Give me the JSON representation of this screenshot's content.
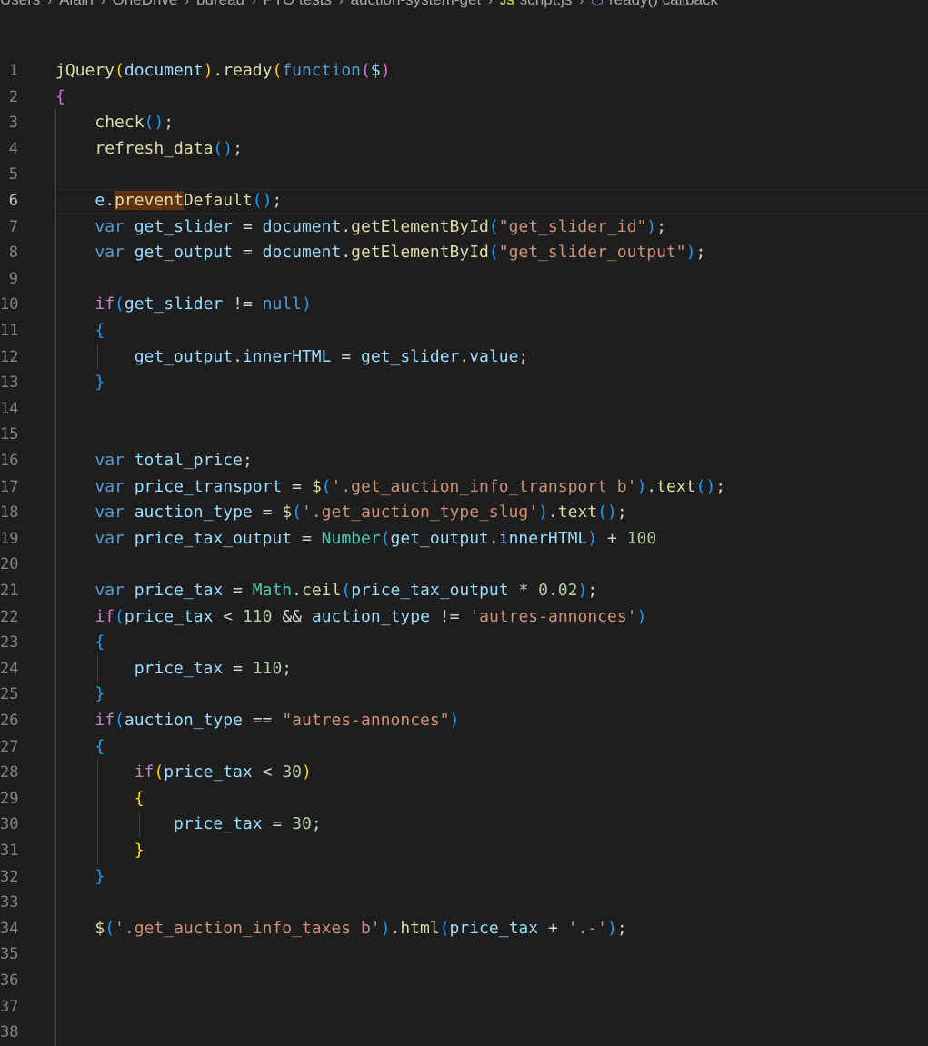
{
  "breadcrumb": {
    "items": [
      "Users",
      "Alain",
      "OneDrive",
      "bureau",
      "PTO tests",
      "auction-system-get"
    ],
    "file_badge": "JS",
    "file_name": "script.js",
    "symbol_name": "ready() callback"
  },
  "editor": {
    "language": "javascript",
    "current_line": 6,
    "lines": [
      {
        "number": "1",
        "text": "jQuery(document).ready(function($)"
      },
      {
        "number": "2",
        "text": "{"
      },
      {
        "number": "3",
        "text": "    check();"
      },
      {
        "number": "4",
        "text": "    refresh_data();"
      },
      {
        "number": "5",
        "text": ""
      },
      {
        "number": "6",
        "text": "    e.preventDefault();"
      },
      {
        "number": "7",
        "text": "    var get_slider = document.getElementById(\"get_slider_id\");"
      },
      {
        "number": "8",
        "text": "    var get_output = document.getElementById(\"get_slider_output\");"
      },
      {
        "number": "9",
        "text": ""
      },
      {
        "number": "10",
        "text": "    if(get_slider != null)"
      },
      {
        "number": "11",
        "text": "    {"
      },
      {
        "number": "12",
        "text": "        get_output.innerHTML = get_slider.value;"
      },
      {
        "number": "13",
        "text": "    }"
      },
      {
        "number": "14",
        "text": ""
      },
      {
        "number": "15",
        "text": ""
      },
      {
        "number": "16",
        "text": "    var total_price;"
      },
      {
        "number": "17",
        "text": "    var price_transport = $('.get_auction_info_transport b').text();"
      },
      {
        "number": "18",
        "text": "    var auction_type = $('.get_auction_type_slug').text();"
      },
      {
        "number": "19",
        "text": "    var price_tax_output = Number(get_output.innerHTML) + 100"
      },
      {
        "number": "20",
        "text": ""
      },
      {
        "number": "21",
        "text": "    var price_tax = Math.ceil(price_tax_output * 0.02);"
      },
      {
        "number": "22",
        "text": "    if(price_tax < 110 && auction_type != 'autres-annonces')"
      },
      {
        "number": "23",
        "text": "    {"
      },
      {
        "number": "24",
        "text": "        price_tax = 110;"
      },
      {
        "number": "25",
        "text": "    }"
      },
      {
        "number": "26",
        "text": "    if(auction_type == \"autres-annonces\")"
      },
      {
        "number": "27",
        "text": "    {"
      },
      {
        "number": "28",
        "text": "        if(price_tax < 30)"
      },
      {
        "number": "29",
        "text": "        {"
      },
      {
        "number": "30",
        "text": "            price_tax = 30;"
      },
      {
        "number": "31",
        "text": "        }"
      },
      {
        "number": "32",
        "text": "    }"
      },
      {
        "number": "33",
        "text": ""
      },
      {
        "number": "34",
        "text": "    $('.get_auction_info_taxes b').html(price_tax + '.-');"
      },
      {
        "number": "35",
        "text": ""
      },
      {
        "number": "36",
        "text": ""
      },
      {
        "number": "37",
        "text": ""
      },
      {
        "number": "38",
        "text": ""
      }
    ]
  },
  "colors": {
    "background": "#1e1e1e",
    "keyword": "#569cd6",
    "control": "#c586c0",
    "function": "#dcdcaa",
    "variable": "#9cdcfe",
    "string": "#ce9178",
    "number": "#b5cea8",
    "highlight": "#613214"
  }
}
